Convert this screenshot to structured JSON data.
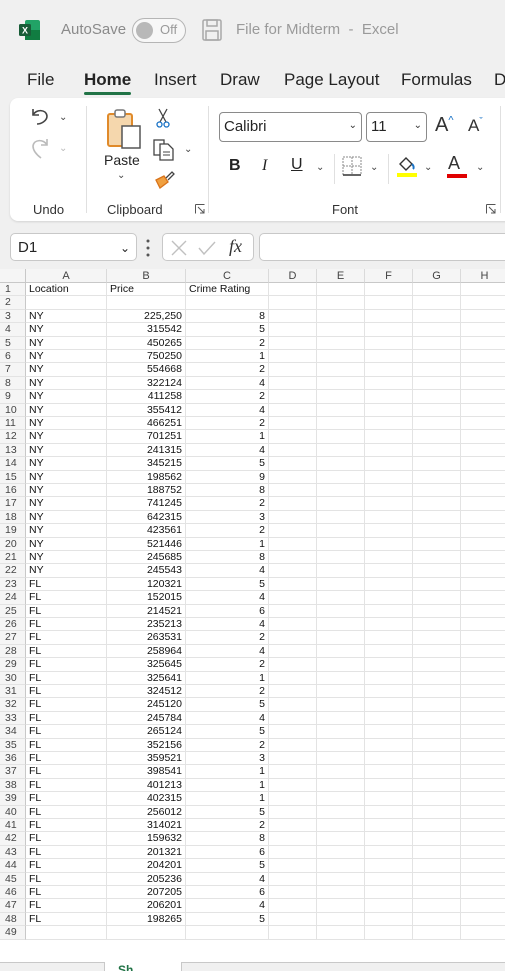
{
  "titlebar": {
    "autosave_label": "AutoSave",
    "autosave_state": "Off",
    "document_title": "File for Midterm  -  Excel"
  },
  "tabs": [
    {
      "label": "File",
      "active": false
    },
    {
      "label": "Home",
      "active": true
    },
    {
      "label": "Insert",
      "active": false
    },
    {
      "label": "Draw",
      "active": false
    },
    {
      "label": "Page Layout",
      "active": false
    },
    {
      "label": "Formulas",
      "active": false
    },
    {
      "label": "D",
      "active": false
    }
  ],
  "ribbon": {
    "undo_group_label": "Undo",
    "clipboard_group_label": "Clipboard",
    "paste_label": "Paste",
    "font_group_label": "Font",
    "font_name": "Calibri",
    "font_size": "11",
    "bold_label": "B",
    "italic_label": "I",
    "underline_label": "U",
    "font_color_label": "A",
    "highlight_color": "#ffff00",
    "font_color": "#e00000",
    "grow_font_label": "A",
    "shrink_font_label": "A"
  },
  "formula_bar": {
    "name_box": "D1",
    "fx_label": "fx",
    "formula_value": ""
  },
  "sheet": {
    "columns": [
      "A",
      "B",
      "C",
      "D",
      "E",
      "F",
      "G",
      "H"
    ],
    "header_row": {
      "row": "1",
      "A": "Location",
      "B": "Price",
      "C": "Crime Rating"
    },
    "rows": [
      {
        "row": "2",
        "A": "",
        "B": "",
        "C": ""
      },
      {
        "row": "3",
        "A": "NY",
        "B": "225,250",
        "C": "8"
      },
      {
        "row": "4",
        "A": "NY",
        "B": "315542",
        "C": "5"
      },
      {
        "row": "5",
        "A": "NY",
        "B": "450265",
        "C": "2"
      },
      {
        "row": "6",
        "A": "NY",
        "B": "750250",
        "C": "1"
      },
      {
        "row": "7",
        "A": "NY",
        "B": "554668",
        "C": "2"
      },
      {
        "row": "8",
        "A": "NY",
        "B": "322124",
        "C": "4"
      },
      {
        "row": "9",
        "A": "NY",
        "B": "411258",
        "C": "2"
      },
      {
        "row": "10",
        "A": "NY",
        "B": "355412",
        "C": "4"
      },
      {
        "row": "11",
        "A": "NY",
        "B": "466251",
        "C": "2"
      },
      {
        "row": "12",
        "A": "NY",
        "B": "701251",
        "C": "1"
      },
      {
        "row": "13",
        "A": "NY",
        "B": "241315",
        "C": "4"
      },
      {
        "row": "14",
        "A": "NY",
        "B": "345215",
        "C": "5"
      },
      {
        "row": "15",
        "A": "NY",
        "B": "198562",
        "C": "9"
      },
      {
        "row": "16",
        "A": "NY",
        "B": "188752",
        "C": "8"
      },
      {
        "row": "17",
        "A": "NY",
        "B": "741245",
        "C": "2"
      },
      {
        "row": "18",
        "A": "NY",
        "B": "642315",
        "C": "3"
      },
      {
        "row": "19",
        "A": "NY",
        "B": "423561",
        "C": "2"
      },
      {
        "row": "20",
        "A": "NY",
        "B": "521446",
        "C": "1"
      },
      {
        "row": "21",
        "A": "NY",
        "B": "245685",
        "C": "8"
      },
      {
        "row": "22",
        "A": "NY",
        "B": "245543",
        "C": "4"
      },
      {
        "row": "23",
        "A": "FL",
        "B": "120321",
        "C": "5"
      },
      {
        "row": "24",
        "A": "FL",
        "B": "152015",
        "C": "4"
      },
      {
        "row": "25",
        "A": "FL",
        "B": "214521",
        "C": "6"
      },
      {
        "row": "26",
        "A": "FL",
        "B": "235213",
        "C": "4"
      },
      {
        "row": "27",
        "A": "FL",
        "B": "263531",
        "C": "2"
      },
      {
        "row": "28",
        "A": "FL",
        "B": "258964",
        "C": "4"
      },
      {
        "row": "29",
        "A": "FL",
        "B": "325645",
        "C": "2"
      },
      {
        "row": "30",
        "A": "FL",
        "B": "325641",
        "C": "1"
      },
      {
        "row": "31",
        "A": "FL",
        "B": "324512",
        "C": "2"
      },
      {
        "row": "32",
        "A": "FL",
        "B": "245120",
        "C": "5"
      },
      {
        "row": "33",
        "A": "FL",
        "B": "245784",
        "C": "4"
      },
      {
        "row": "34",
        "A": "FL",
        "B": "265124",
        "C": "5"
      },
      {
        "row": "35",
        "A": "FL",
        "B": "352156",
        "C": "2"
      },
      {
        "row": "36",
        "A": "FL",
        "B": "359521",
        "C": "3"
      },
      {
        "row": "37",
        "A": "FL",
        "B": "398541",
        "C": "1"
      },
      {
        "row": "38",
        "A": "FL",
        "B": "401213",
        "C": "1"
      },
      {
        "row": "39",
        "A": "FL",
        "B": "402315",
        "C": "1"
      },
      {
        "row": "40",
        "A": "FL",
        "B": "256012",
        "C": "5"
      },
      {
        "row": "41",
        "A": "FL",
        "B": "314021",
        "C": "2"
      },
      {
        "row": "42",
        "A": "FL",
        "B": "159632",
        "C": "8"
      },
      {
        "row": "43",
        "A": "FL",
        "B": "201321",
        "C": "6"
      },
      {
        "row": "44",
        "A": "FL",
        "B": "204201",
        "C": "5"
      },
      {
        "row": "45",
        "A": "FL",
        "B": "205236",
        "C": "4"
      },
      {
        "row": "46",
        "A": "FL",
        "B": "207205",
        "C": "6"
      },
      {
        "row": "47",
        "A": "FL",
        "B": "206201",
        "C": "4"
      },
      {
        "row": "48",
        "A": "FL",
        "B": "198265",
        "C": "5"
      },
      {
        "row": "49",
        "A": "",
        "B": "",
        "C": ""
      }
    ]
  },
  "colors": {
    "accent": "#217346",
    "excel_green": "#107c41"
  }
}
